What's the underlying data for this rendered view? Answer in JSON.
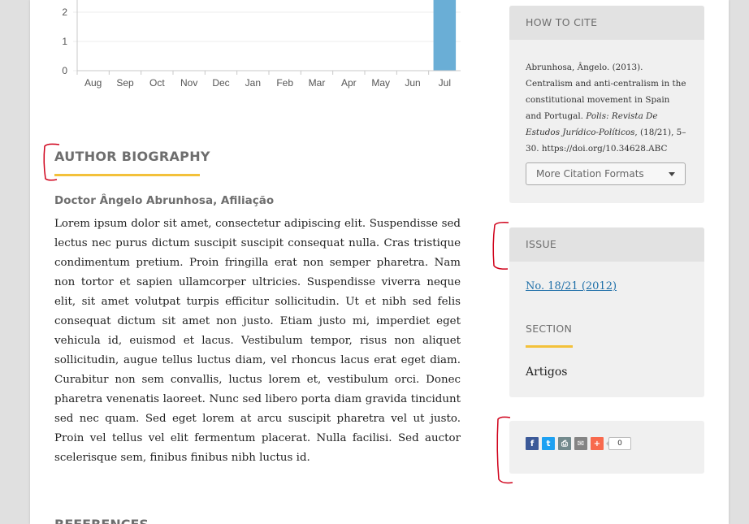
{
  "chart_data": {
    "type": "bar",
    "categories": [
      "Aug",
      "Sep",
      "Oct",
      "Nov",
      "Dec",
      "Jan",
      "Feb",
      "Mar",
      "Apr",
      "May",
      "Jun",
      "Jul"
    ],
    "values": [
      0,
      0,
      0,
      0,
      0,
      0,
      0,
      0,
      0,
      0,
      0,
      3
    ],
    "yticks": [
      0,
      1,
      2
    ],
    "ylim": [
      0,
      3
    ],
    "bar_color": "#6aaed6"
  },
  "author": {
    "heading": "AUTHOR BIOGRAPHY",
    "name": "Doctor Ângelo Abrunhosa, Afiliação",
    "bio": "Lorem ipsum dolor sit amet, consectetur adipiscing elit. Suspendisse sed lectus nec purus dictum suscipit suscipit consequat nulla. Cras tristique condimentum pretium. Proin fringilla erat non semper pharetra. Nam non tortor et sapien ullamcorper ultricies. Suspendisse viverra neque elit, sit amet volutpat turpis efficitur sollicitudin. Ut et nibh sed felis consequat dictum sit amet non justo. Etiam justo mi, imperdiet eget vehicula id, euismod et lacus. Vestibulum tempor, risus non aliquet sollicitudin, augue tellus luctus diam, vel rhoncus lacus erat eget diam. Curabitur non sem convallis, luctus lorem et, vestibulum orci. Donec pharetra venenatis laoreet. Nunc sed libero porta diam gravida tincidunt sed nec quam. Sed eget lorem at arcu suscipit pharetra vel ut justo. Proin vel tellus vel elit fermentum placerat. Nulla facilisi. Sed auctor scelerisque sem, finibus finibus nibh luctus id."
  },
  "references": {
    "heading": "REFERENCES"
  },
  "how_to_cite": {
    "heading": "HOW TO CITE",
    "text_plain": "Abrunhosa, Ângelo. (2013). Centralism and anti-centralism in the constitutional movement in Spain and Portugal. ",
    "text_italic": "Polis: Revista De Estudos Jurídico-Políticos",
    "text_tail": ", (18/21), 5–30. https://doi.org/10.34628.ABC",
    "button_label": "More Citation Formats"
  },
  "issue": {
    "heading": "ISSUE",
    "link": "No. 18/21 (2012)",
    "section_heading": "SECTION",
    "section_value": "Artigos"
  },
  "share": {
    "icons": [
      {
        "name": "facebook-icon",
        "glyph": "f",
        "color": "#3b5998"
      },
      {
        "name": "twitter-icon",
        "glyph": "t",
        "color": "#1da1f2"
      },
      {
        "name": "print-icon",
        "glyph": "⎙",
        "color": "#738a8d"
      },
      {
        "name": "email-icon",
        "glyph": "✉",
        "color": "#848484"
      },
      {
        "name": "addthis-plus-icon",
        "glyph": "+",
        "color": "#f8694d"
      }
    ],
    "count": "0"
  },
  "colors": {
    "accent": "#f3c13a",
    "annotation": "#d0021b",
    "link": "#1e6fa8"
  }
}
